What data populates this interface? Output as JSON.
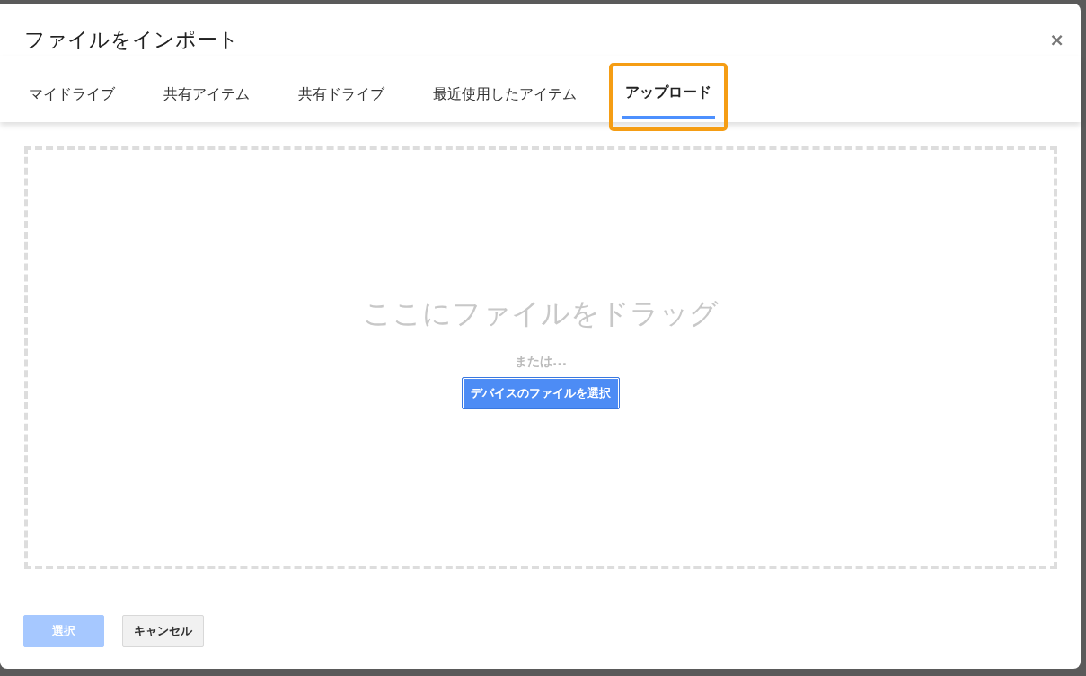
{
  "dialog": {
    "title": "ファイルをインポート",
    "close": "×"
  },
  "tabs": [
    {
      "label": "マイドライブ",
      "selected": false,
      "highlighted": false
    },
    {
      "label": "共有アイテム",
      "selected": false,
      "highlighted": false
    },
    {
      "label": "共有ドライブ",
      "selected": false,
      "highlighted": false
    },
    {
      "label": "最近使用したアイテム",
      "selected": false,
      "highlighted": false
    },
    {
      "label": "アップロード",
      "selected": true,
      "highlighted": true
    }
  ],
  "dropzone": {
    "heading": "ここにファイルをドラッグ",
    "or": "または...",
    "button": "デバイスのファイルを選択"
  },
  "buttons": [
    {
      "label": "選択",
      "kind": "primary",
      "disabled": true
    },
    {
      "label": "キャンセル",
      "kind": "secondary",
      "disabled": false
    }
  ]
}
